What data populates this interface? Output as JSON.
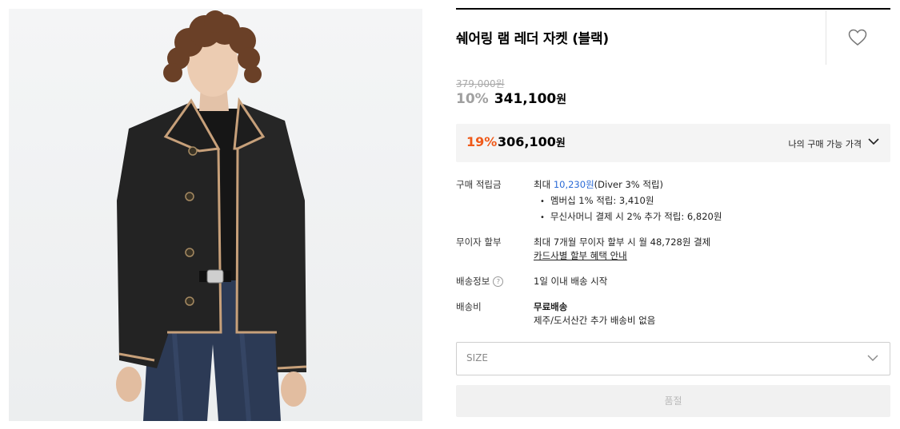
{
  "product": {
    "title": "쉐어링 램 레더 자켓 (블랙)",
    "original_price": "379,000원",
    "discount_rate": "10%",
    "sale_price": "341,100",
    "currency": "원"
  },
  "member_price": {
    "rate": "19%",
    "price": "306,100",
    "currency": "원",
    "label": "나의 구매 가능 가격"
  },
  "points": {
    "label": "구매 적립금",
    "prefix": "최대 ",
    "amount": "10,230원",
    "suffix": "(Diver 3% 적립)",
    "items": [
      "멤버십 1% 적립: 3,410원",
      "무신사머니 결제 시 2% 추가 적립: 6,820원"
    ]
  },
  "installment": {
    "label": "무이자 할부",
    "text": "최대 7개월 무이자 할부 시 월 48,728원 결제",
    "link": "카드사별 할부 혜택 안내"
  },
  "shipping_info": {
    "label": "배송정보",
    "help": "?",
    "text": "1일 이내 배송 시작"
  },
  "shipping_fee": {
    "label": "배송비",
    "text": "무료배송",
    "note": "제주/도서산간 추가 배송비 없음"
  },
  "size_select": {
    "placeholder": "SIZE"
  },
  "buy_button": {
    "label": "품절"
  },
  "icons": {
    "wishlist": "heart-outline-icon",
    "member_toggle": "chevron-down-icon",
    "size_toggle": "chevron-down-icon"
  },
  "colors": {
    "accent": "#ef5a1a",
    "link_blue": "#2b6bd6"
  }
}
